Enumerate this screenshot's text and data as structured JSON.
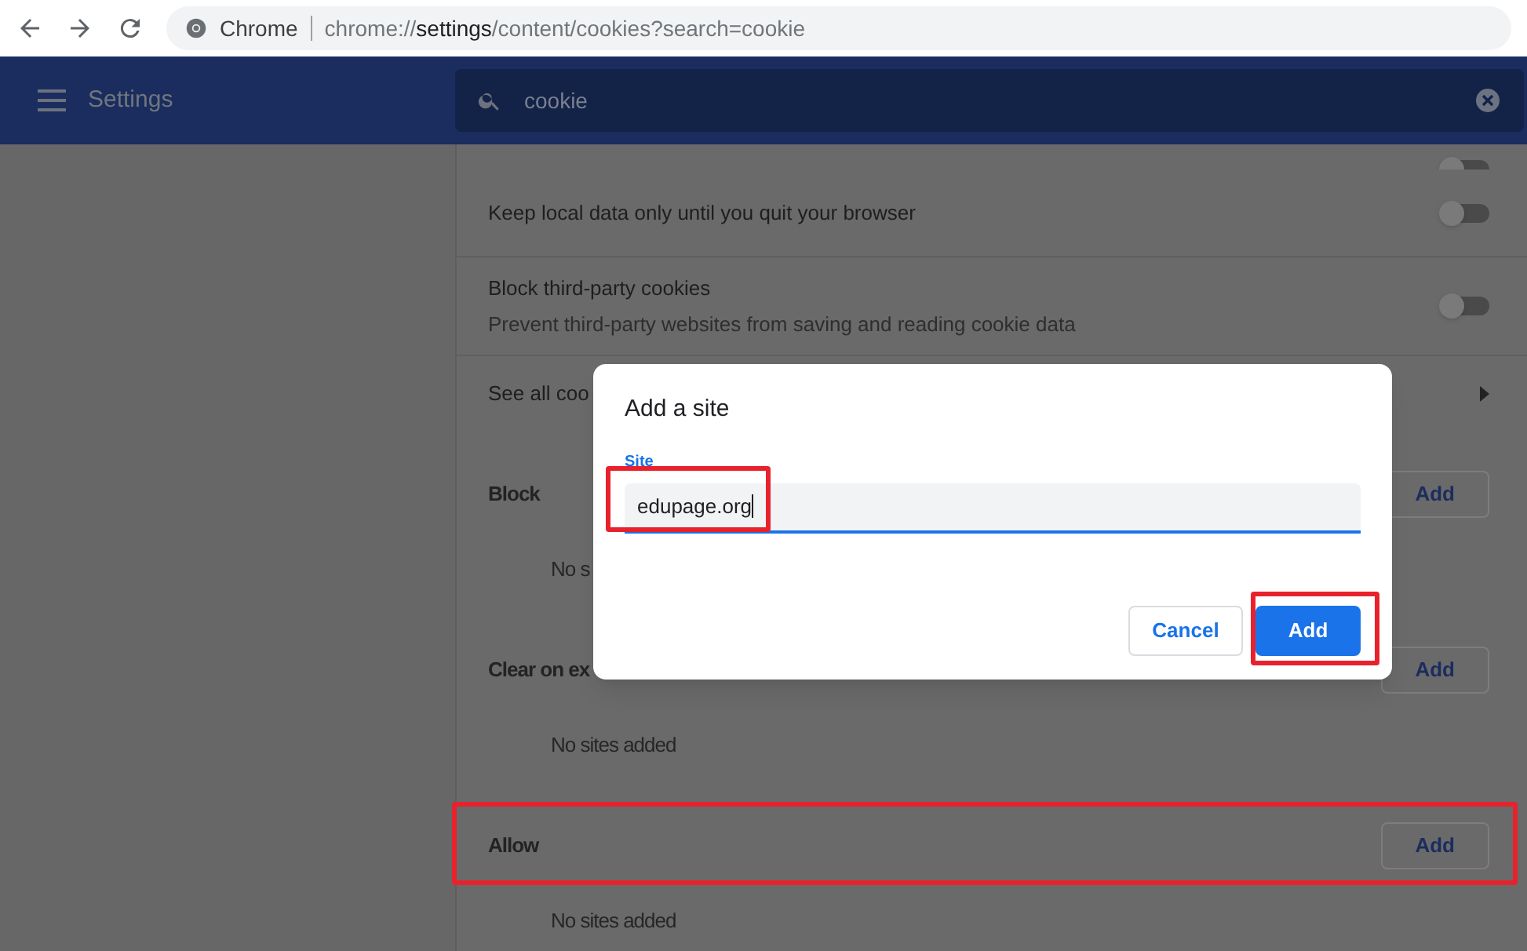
{
  "browser": {
    "site_label": "Chrome",
    "url_parts": [
      {
        "text": "chrome://",
        "emphasis": false
      },
      {
        "text": "settings",
        "emphasis": true
      },
      {
        "text": "/content/cookies?search=cookie",
        "emphasis": false
      }
    ]
  },
  "header": {
    "title": "Settings",
    "search": {
      "value": "cookie"
    }
  },
  "rows": [
    {
      "kind": "toggle",
      "on": false
    },
    {
      "kind": "toggle",
      "label": "Keep local data only until you quit your browser",
      "on": false
    },
    {
      "kind": "toggle",
      "label": "Block third-party cookies",
      "description": "Prevent third-party websites from saving and reading cookie data",
      "on": false
    },
    {
      "kind": "link",
      "label": "See all coo"
    }
  ],
  "sections": [
    {
      "title": "Block",
      "button": "Add",
      "empty_text": "No s"
    },
    {
      "title": "Clear on ex",
      "button": "Add",
      "empty_text": "No sites added"
    },
    {
      "title": "Allow",
      "button": "Add",
      "empty_text": "No sites added"
    }
  ],
  "dialog": {
    "title": "Add a site",
    "field_label": "Site",
    "field_value": "edupage.org",
    "cancel": "Cancel",
    "confirm": "Add"
  }
}
